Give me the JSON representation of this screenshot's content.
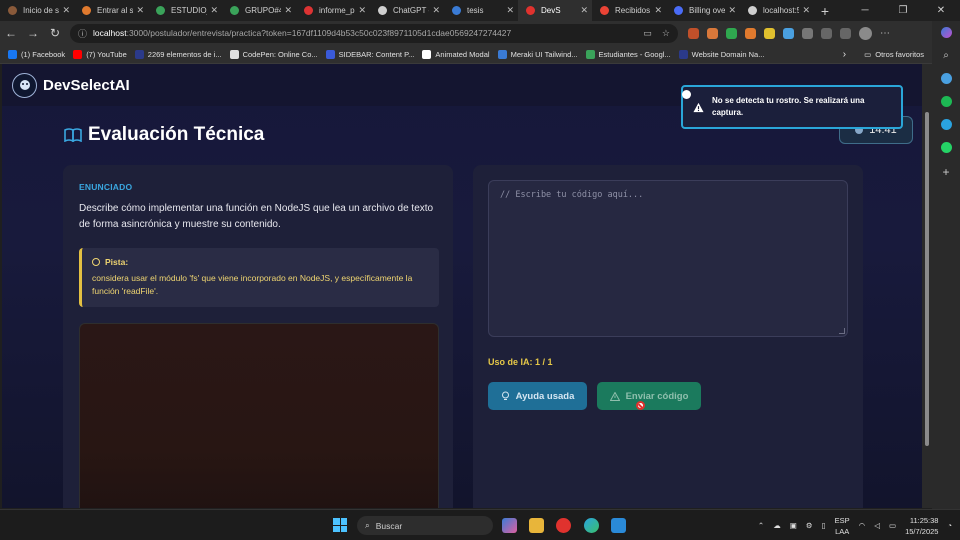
{
  "browser": {
    "tabs": [
      {
        "label": "Inicio de s",
        "color": "#8a5a3a"
      },
      {
        "label": "Entrar al si",
        "color": "#e07a2e"
      },
      {
        "label": "ESTUDIO_",
        "color": "#3aa35a"
      },
      {
        "label": "GRUPO#4",
        "color": "#3aa35a"
      },
      {
        "label": "informe_p",
        "color": "#d33"
      },
      {
        "label": "ChatGPT -",
        "color": "#cfcfcf"
      },
      {
        "label": "tesis",
        "color": "#3a7bd5"
      },
      {
        "label": "DevS",
        "color": "#e0322e"
      },
      {
        "label": "Recibidos",
        "color": "#ea4335"
      },
      {
        "label": "Billing ove",
        "color": "#4a6cf7"
      },
      {
        "label": "localhost:5",
        "color": "#cfcfcf"
      }
    ],
    "url_host": "localhost",
    "url_path": ":3000/postulador/entrevista/practica?token=167df1109d4b53c50c023f8971105d1cdae0569247274427",
    "bookmarks": [
      {
        "label": "(1) Facebook",
        "color": "#1877f2"
      },
      {
        "label": "(7) YouTube",
        "color": "#ff0000"
      },
      {
        "label": "2269 elementos de i...",
        "color": "#2b3a8a"
      },
      {
        "label": "CodePen: Online Co...",
        "color": "#e0e0e0"
      },
      {
        "label": "SIDEBAR: Content P...",
        "color": "#3a5ad9"
      },
      {
        "label": "Animated Modal",
        "color": "#ffffff"
      },
      {
        "label": "Meraki UI Tailwind...",
        "color": "#3a7bd5"
      },
      {
        "label": "Estudiantes - Googl...",
        "color": "#3aa35a"
      },
      {
        "label": "Website Domain Na...",
        "color": "#2b3a8a"
      }
    ],
    "other_favorites": "Otros favoritos"
  },
  "app": {
    "brand": "DevSelectAI",
    "page_title": "Evaluación Técnica",
    "timer": "14:41",
    "toast": "No se detecta tu rostro. Se realizará una captura.",
    "statement_label": "ENUNCIADO",
    "statement": "Describe cómo implementar una función en NodeJS que lea un archivo de texto de forma asincrónica y muestre su contenido.",
    "hint_title": "Pista:",
    "hint_text": "considera usar el módulo 'fs' que viene incorporado en NodeJS, y específicamente la función 'readFile'.",
    "editor_placeholder": "// Escribe tu código aquí...",
    "ai_usage": "Uso de IA: 1 / 1",
    "help_button": "Ayuda usada",
    "submit_button": "Enviar código"
  },
  "taskbar": {
    "search": "Buscar",
    "lang1": "ESP",
    "lang2": "LAA",
    "time": "11:25:38",
    "date": "15/7/2025"
  },
  "colors": {
    "accent": "#3aa7e0",
    "hint": "#efd571",
    "help_button": "#1f6f97",
    "submit_button": "#1b7a5d"
  }
}
